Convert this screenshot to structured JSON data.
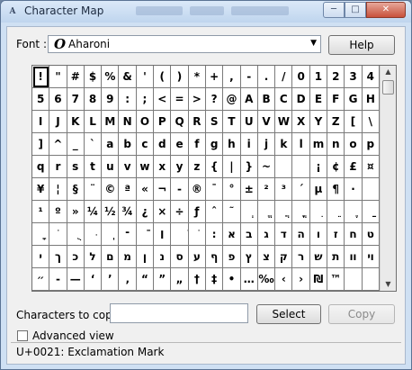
{
  "window": {
    "title": "Character Map"
  },
  "font": {
    "label": "Font :",
    "selected": "Aharoni",
    "help_label": "Help",
    "icon": "opentype-font-icon"
  },
  "grid": {
    "selected_index": 0,
    "cells": [
      "!",
      "\"",
      "#",
      "$",
      "%",
      "&",
      "'",
      "(",
      ")",
      "*",
      "+",
      ",",
      "-",
      ".",
      "/",
      "0",
      "1",
      "2",
      "3",
      "4",
      "5",
      "6",
      "7",
      "8",
      "9",
      ":",
      ";",
      "<",
      "=",
      ">",
      "?",
      "@",
      "A",
      "B",
      "C",
      "D",
      "E",
      "F",
      "G",
      "H",
      "I",
      "J",
      "K",
      "L",
      "M",
      "N",
      "O",
      "P",
      "Q",
      "R",
      "S",
      "T",
      "U",
      "V",
      "W",
      "X",
      "Y",
      "Z",
      "[",
      "\\",
      "]",
      "^",
      "_",
      "`",
      "a",
      "b",
      "c",
      "d",
      "e",
      "f",
      "g",
      "h",
      "i",
      "j",
      "k",
      "l",
      "m",
      "n",
      "o",
      "p",
      "q",
      "r",
      "s",
      "t",
      "u",
      "v",
      "w",
      "x",
      "y",
      "z",
      "{",
      "|",
      "}",
      "~",
      "",
      "",
      "¡",
      "¢",
      "£",
      "¤",
      "¥",
      "¦",
      "§",
      "¨",
      "©",
      "ª",
      "«",
      "¬",
      "-",
      "®",
      "¯",
      "°",
      "±",
      "²",
      "³",
      "´",
      "µ",
      "¶",
      "·",
      "",
      "¹",
      "º",
      "»",
      "¼",
      "½",
      "¾",
      "¿",
      "×",
      "÷",
      "ƒ",
      "ˆ",
      "˜",
      "ְ",
      "ֱ",
      "ֲ",
      "ֳ",
      "ִ",
      "ֵ",
      "ֶ",
      "ַ",
      "ָ",
      "ֹ",
      "ֻ",
      "ּ",
      "ֽ",
      "־",
      "ֿ",
      "׀",
      "ׁ",
      "ׂ",
      "׃",
      "א",
      "ב",
      "ג",
      "ד",
      "ה",
      "ו",
      "ז",
      "ח",
      "ט",
      "י",
      "ך",
      "כ",
      "ל",
      "ם",
      "מ",
      "ן",
      "נ",
      "ס",
      "ע",
      "ף",
      "פ",
      "ץ",
      "צ",
      "ק",
      "ר",
      "ש",
      "ת",
      "װ",
      "ױ",
      "״",
      "-",
      "—",
      "‘",
      "’",
      "‚",
      "“",
      "”",
      "„",
      "†",
      "‡",
      "•",
      "…",
      "‰",
      "‹",
      "›",
      "₪",
      "™",
      "",
      ""
    ]
  },
  "copy": {
    "label": "Characters to copy",
    "value": "",
    "select_label": "Select",
    "copy_label": "Copy"
  },
  "advanced": {
    "label": "Advanced view",
    "checked": false
  },
  "status": {
    "text": "U+0021: Exclamation Mark"
  }
}
